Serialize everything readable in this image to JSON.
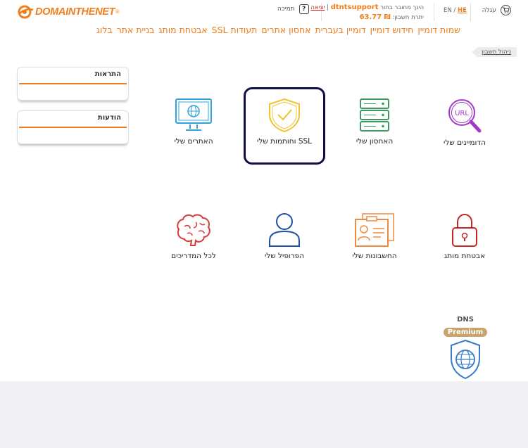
{
  "brand": {
    "logo_text": "DOMAINTHENET",
    "logo_reg": "®",
    "accent": "#f07e1c",
    "selected_border": "#101048"
  },
  "header": {
    "support_label": "תמיכה",
    "support_icon": "question-icon",
    "connected_as_prefix": "הינך מחובר בתור",
    "username": "dtntsupport",
    "logout": "יציאה",
    "balance_label": "יתרת חשבון:",
    "balance_value": "₪ 63.77",
    "lang_en": "EN",
    "lang_sep": " / ",
    "lang_he": "HE",
    "cart_label": "עגלה",
    "cart_icon": "cart-icon"
  },
  "nav": {
    "items": [
      {
        "label": "שמות דומיין"
      },
      {
        "label": "חידוש דומיין"
      },
      {
        "label": "דומיין בעברית"
      },
      {
        "label": "אחסון אתרים"
      },
      {
        "label": "תעודות SSL"
      },
      {
        "label": "אבטחת מותג"
      },
      {
        "label": "בניית אתר"
      },
      {
        "label": "בלוג"
      }
    ]
  },
  "breadcrumb": {
    "label": "ניהול חשבון"
  },
  "sidebar": {
    "alerts_title": "התראות",
    "messages_title": "הודעות"
  },
  "tiles": {
    "domains": {
      "label": "הדומיינים שלי",
      "icon": "url-magnifier-icon",
      "icon_text": "URL",
      "color": "#a23ac8"
    },
    "hosting": {
      "label": "האחסון שלי",
      "icon": "server-icon",
      "color": "#3c9a5f"
    },
    "ssl": {
      "label": "SSL וחותמות שלי",
      "icon": "shield-check-icon",
      "color": "#f2c330"
    },
    "sites": {
      "label": "האתרים שלי",
      "icon": "monitor-globe-icon",
      "color": "#2ea3dc"
    },
    "brand_security": {
      "label": "אבטחת מותג",
      "icon": "padlock-icon",
      "color": "#c62828"
    },
    "accounts": {
      "label": "החשבונות שלי",
      "icon": "id-cards-icon",
      "color": "#f08a3c"
    },
    "profile": {
      "label": "הפרופיל שלי",
      "icon": "user-icon",
      "color": "#1f4fa3"
    },
    "guides": {
      "label": "לכל המדריכים",
      "icon": "brain-icon",
      "color": "#d93a3a"
    }
  },
  "dns_premium": {
    "title": "DNS",
    "badge": "Premium",
    "icon": "globe-shield-icon",
    "color": "#3a7bc8"
  }
}
